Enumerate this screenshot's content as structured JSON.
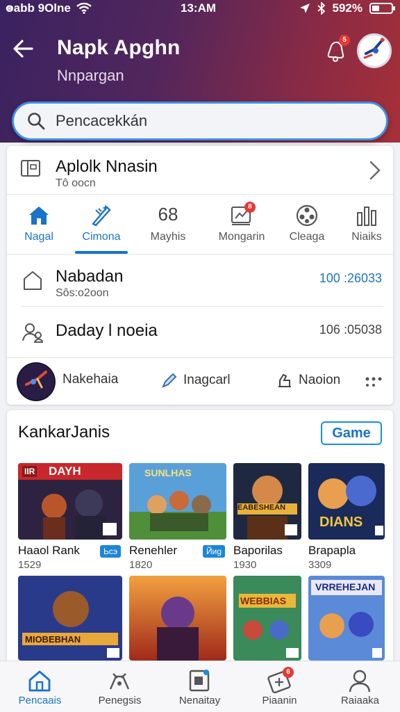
{
  "status_bar": {
    "carrier": "ꙩabb 9Olne",
    "time": "13:AM",
    "battery": "592%"
  },
  "header": {
    "title": "Napk Apghn",
    "subtitle": "Nnpargan",
    "notification_badge": "5"
  },
  "search": {
    "placeholder": "Pencaᴄɐkkán"
  },
  "app_row": {
    "title": "Aplolk Nnasin",
    "subtitle": "Tô oocn"
  },
  "tabs": [
    {
      "label": "Nagal",
      "icon": "home-icon",
      "active": false
    },
    {
      "label": "Cimona",
      "icon": "sparkle-icon",
      "active": true
    },
    {
      "label": "Mayhis",
      "icon": "number-icon",
      "active": false
    },
    {
      "label": "Mongarin",
      "icon": "message-icon",
      "badge": "8",
      "active": false
    },
    {
      "label": "Cleaga",
      "icon": "film-reel-icon",
      "active": false
    },
    {
      "label": "Niaiks",
      "icon": "bar-chart-icon",
      "active": false
    }
  ],
  "tab_number_glyph": "68",
  "stat_rows": [
    {
      "title": "Nabadan",
      "subtitle": "Sôs:o2oon",
      "value": "100 :26033",
      "accent": "#1a73c9"
    },
    {
      "title": "Daday l noeia",
      "subtitle": "",
      "value": "106 :05038",
      "accent": "#444444"
    }
  ],
  "quick_actions": [
    {
      "label": "Nakehaia",
      "icon": "avatar-icon"
    },
    {
      "label": "Inagcarl",
      "icon": "pen-icon"
    },
    {
      "label": "Naoion",
      "icon": "cart-icon"
    }
  ],
  "games": {
    "section_title": "KankarJanis",
    "tag_label": "Game",
    "tiles": [
      {
        "caption": "Haaol Rank",
        "count": "1529",
        "tag": "Ьсэ",
        "banner": "DAYH",
        "banner_tag": "IIR"
      },
      {
        "caption": "Renehler",
        "count": "1820",
        "tag": "Йиg",
        "banner": "SUNLHAS"
      },
      {
        "caption": "Baporilas",
        "count": "1930",
        "banner": "EABESHEAN"
      },
      {
        "caption": "Brapapla",
        "count": "3309",
        "banner": "DIANS"
      },
      {
        "caption": "",
        "count": "",
        "banner": "MIOBEBHAN"
      },
      {
        "caption": "",
        "count": "",
        "banner": ""
      },
      {
        "caption": "",
        "count": "",
        "banner": "WEBBIAS"
      },
      {
        "caption": "",
        "count": "",
        "banner": "VRREHEJAN"
      }
    ]
  },
  "bottom_nav": [
    {
      "label": "Pencaais",
      "icon": "home-icon",
      "active": true
    },
    {
      "label": "Penegsis",
      "icon": "controller-icon",
      "active": false
    },
    {
      "label": "Nenaitay",
      "icon": "apps-icon",
      "active": false
    },
    {
      "label": "Piaanin",
      "icon": "ticket-icon",
      "badge": "6",
      "active": false
    },
    {
      "label": "Raiaaka",
      "icon": "profile-icon",
      "active": false
    }
  ],
  "colors": {
    "accent": "#1a73c9",
    "header_start": "#3a2260",
    "header_end": "#a63038",
    "badge": "#e53935"
  }
}
